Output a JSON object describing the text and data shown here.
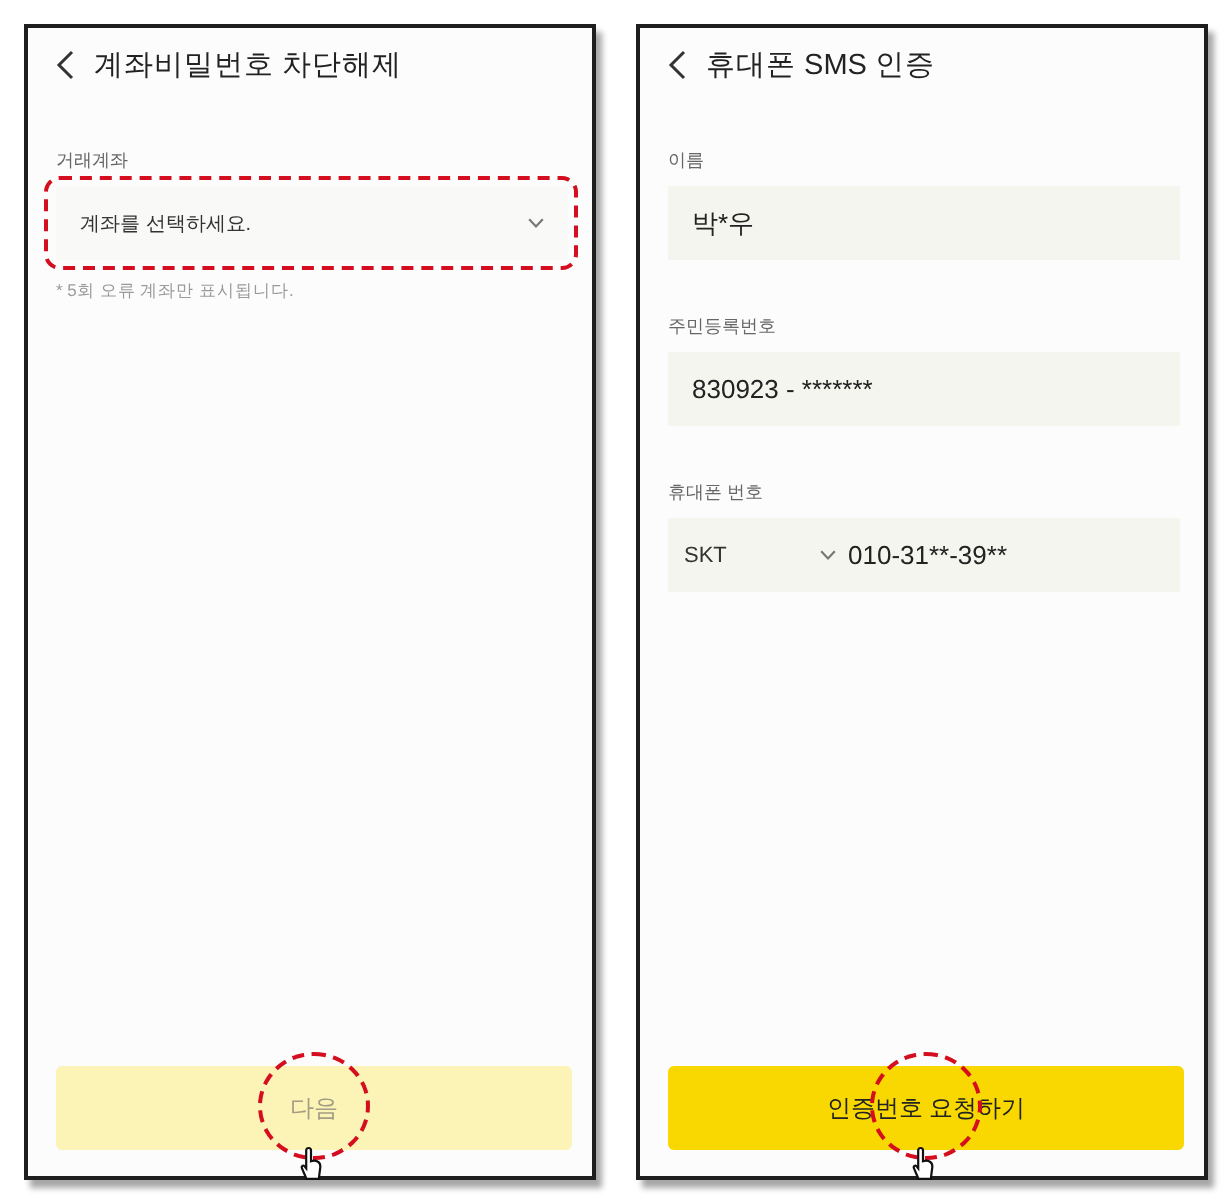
{
  "screens": [
    {
      "title": "계좌비밀번호 차단해제",
      "fields": [
        {
          "kind": "select",
          "label": "거래계좌",
          "placeholder": "계좌를 선택하세요.",
          "highlighted": true
        }
      ],
      "note": "* 5회 오류 계좌만 표시됩니다.",
      "button": {
        "label": "다음",
        "disabled": true,
        "highlighted": true
      }
    },
    {
      "title": "휴대폰 SMS 인증",
      "fields": [
        {
          "kind": "text",
          "label": "이름",
          "value": "박*우",
          "highlighted": false
        },
        {
          "kind": "text",
          "label": "주민등록번호",
          "value": "830923 - *******",
          "highlighted": false
        },
        {
          "kind": "phone",
          "label": "휴대폰 번호",
          "carrier": "SKT",
          "value": "010-31**-39**",
          "highlighted": false
        }
      ],
      "button": {
        "label": "인증번호 요청하기",
        "disabled": false,
        "highlighted": true
      }
    }
  ]
}
